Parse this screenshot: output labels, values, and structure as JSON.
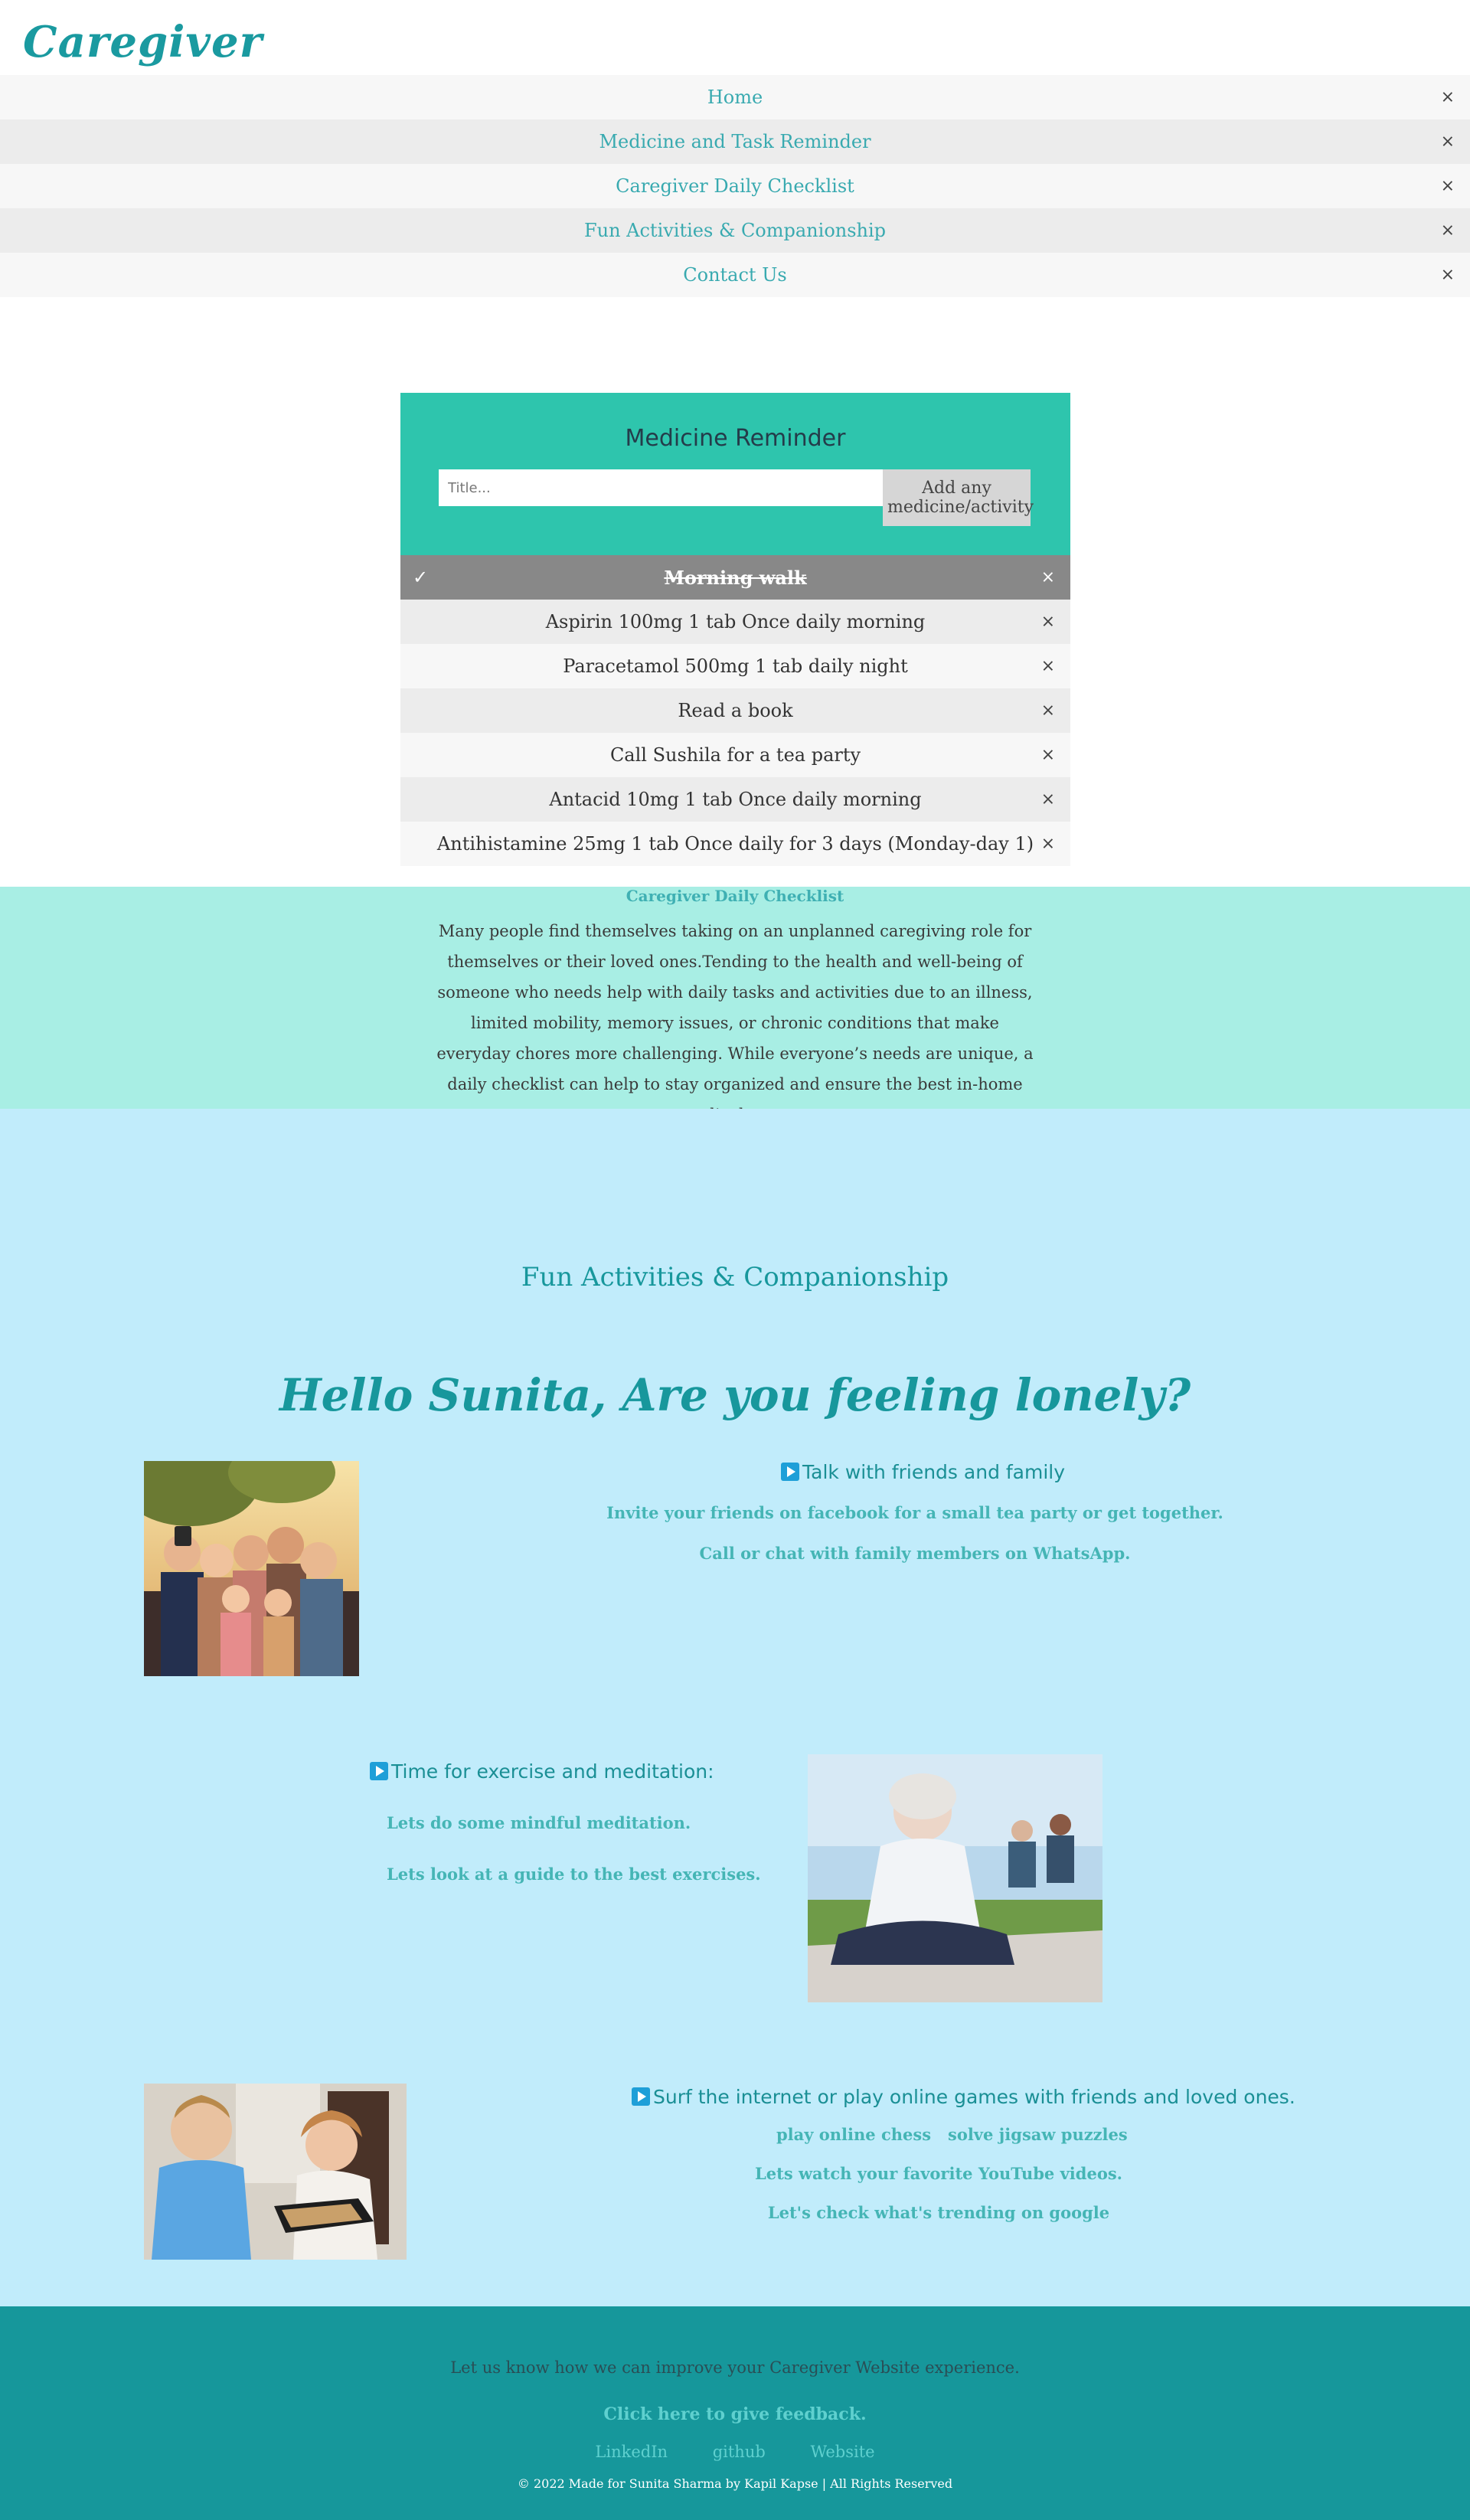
{
  "logo": "Caregiver",
  "nav": {
    "close_symbol": "×",
    "items": [
      "Home",
      "Medicine and Task Reminder",
      "Caregiver Daily Checklist",
      "Fun Activities & Companionship",
      "Contact Us"
    ]
  },
  "reminder": {
    "title": "Medicine Reminder",
    "input_placeholder": "Title...",
    "add_button": "Add any medicine/activity",
    "check_symbol": "✓",
    "close_symbol": "×",
    "items": [
      {
        "text": "Morning walk",
        "checked": true
      },
      {
        "text": "Aspirin 100mg 1 tab Once daily morning",
        "checked": false
      },
      {
        "text": "Paracetamol 500mg 1 tab daily night",
        "checked": false
      },
      {
        "text": "Read a book",
        "checked": false
      },
      {
        "text": "Call Sushila for a tea party",
        "checked": false
      },
      {
        "text": "Antacid 10mg 1 tab Once daily morning",
        "checked": false
      },
      {
        "text": "Antihistamine 25mg 1 tab Once daily for 3 days (Monday-day 1)",
        "checked": false
      }
    ]
  },
  "checklist": {
    "title": "Caregiver Daily Checklist",
    "body": "Many people find themselves taking on an unplanned caregiving role for themselves or their loved ones.Tending to the health and well-being of someone who needs help with daily tasks and activities due to an illness, limited mobility, memory issues, or chronic conditions that make everyday chores more challenging. While everyone’s needs are unique, a daily checklist can help to stay organized and ensure the best in-home medical care."
  },
  "fun": {
    "title": "Fun Activities & Companionship",
    "greeting": "Hello Sunita, Are you feeling lonely?",
    "talk": {
      "heading": "Talk with friends and family",
      "links": [
        "Invite your friends on facebook for a small tea party or get together.",
        "Call or chat with family members on WhatsApp."
      ]
    },
    "exercise": {
      "heading": "Time for exercise and meditation:",
      "links": [
        "Lets do some mindful meditation.",
        "Lets look at a guide to the best exercises."
      ]
    },
    "internet": {
      "heading": "Surf the internet or play online games with friends and loved ones.",
      "links": [
        "play online chess",
        "solve jigsaw puzzles",
        "Lets watch your favorite YouTube videos.",
        "Let's check what's trending on google"
      ]
    }
  },
  "footer": {
    "improve": "Let us know how we can improve your Caregiver Website experience.",
    "feedback": "Click here to give feedback.",
    "links": [
      "LinkedIn",
      "github",
      "Website"
    ],
    "copyright": "© 2022 Made for Sunita Sharma by Kapil Kapse | All Rights Reserved"
  }
}
